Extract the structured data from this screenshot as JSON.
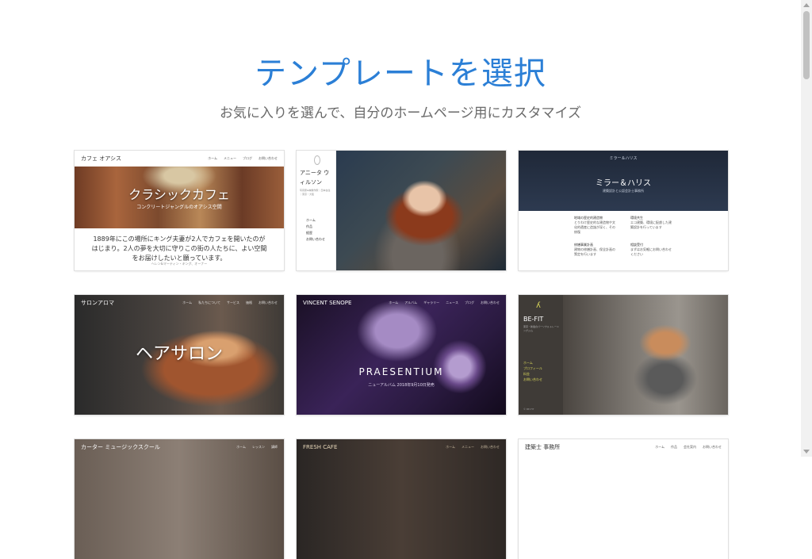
{
  "hero": {
    "title": "テンプレートを選択",
    "subtitle": "お気に入りを選んで、自分のホームページ用にカスタマイズ"
  },
  "templates": [
    {
      "brand": "カフェ オアシス",
      "nav": [
        "ホーム",
        "メニュー",
        "ブログ",
        "お問い合わせ"
      ],
      "title": "クラシックカフェ",
      "subtitle": "コンクリートジャングルのオアシス空間",
      "body": "1889年にこの場所にキング夫妻が2人でカフェを開いたのがはじまり。2人の夢を大切に守りこの街の人たちに、よい空間をお届けしたいと願っています。",
      "credit": "ヘレン&マーティン・キング、オーナー"
    },
    {
      "name": "アニータ ウィルソン",
      "tiny": "写真家&映像作家｜日本在住｜東京・大阪",
      "menu": [
        "ホーム",
        "作品",
        "経歴",
        "お問い合わせ"
      ]
    },
    {
      "top": "ミラー＆ハリス",
      "title": "ミラー＆ハリス",
      "subtitle": "建築設計と公認会計士事務所",
      "features": [
        {
          "title": "地域の歴史的建造物",
          "text": "とりわけ歴史的な建造物や文化的遺産に造詣が深く、その修復"
        },
        {
          "title": "環境共生",
          "text": "エコ建築、環境に配慮した建築設計を行っています"
        },
        {
          "title": "修繕事業計画",
          "text": "建物の修繕計画、保全計画の策定を行います"
        },
        {
          "title": "相談受付",
          "text": "まずはお気軽にお問い合わせください"
        }
      ]
    },
    {
      "brand": "サロンアロマ",
      "nav": [
        "ホーム",
        "私たちについて",
        "サービス",
        "価格",
        "お問い合わせ"
      ],
      "title": "ヘアサロン"
    },
    {
      "brand": "VINCENT SENOPE",
      "nav": [
        "ホーム",
        "アルバム",
        "ギャラリー",
        "ニュース",
        "ブログ",
        "お問い合わせ"
      ],
      "title": "PRAESENTIUM",
      "subtitle": "ニューアルバム 2018年9月10日発売"
    },
    {
      "logo": "ʎ",
      "name": "BE-FIT",
      "tiny": "東京・新宿のパーソナルトレーニングジム",
      "menu": [
        "ホーム",
        "プロフィール",
        "料金",
        "お問い合わせ"
      ],
      "foot": "© BE-FIT"
    },
    {
      "brand": "カーター ミュージックスクール",
      "nav": [
        "ホーム",
        "レッスン",
        "講師"
      ]
    },
    {
      "brand": "FRESH CAFE",
      "nav": [
        "ホーム",
        "メニュー",
        "お問い合わせ"
      ]
    },
    {
      "brand": "建築士 事務所",
      "nav": [
        "ホーム",
        "作品",
        "会社案内",
        "お問い合わせ"
      ]
    }
  ]
}
